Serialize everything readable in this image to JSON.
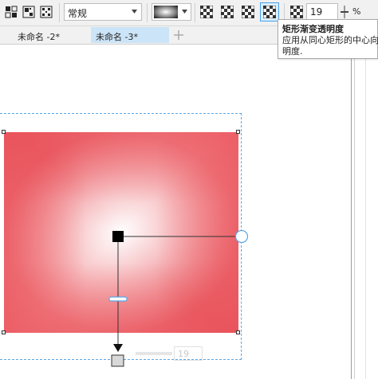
{
  "toolbar": {
    "mode_select": "常规",
    "transparency_value": "19",
    "percent_unit": "%",
    "icons": [
      "image-copy-icon",
      "qr-pattern-icon-1",
      "qr-pattern-icon-2"
    ],
    "checker_buttons": [
      "linear-transparency",
      "elliptical-transparency",
      "conical-transparency",
      "rectangular-transparency"
    ],
    "active_checker": "rectangular-transparency"
  },
  "tabs": [
    {
      "label": "未命名 -2*",
      "active": false
    },
    {
      "label": "未命名 -3*",
      "active": true
    }
  ],
  "add_tab_label": "+",
  "tooltip": {
    "title": "矩形渐变透明度",
    "line1": "应用从同心矩形的中心向",
    "line2": "明度."
  },
  "canvas": {
    "ghost_value": "19",
    "colors": {
      "shape_edge": "#e9555e",
      "shape_center": "#ffffff",
      "selection": "#5aa7e6"
    }
  }
}
